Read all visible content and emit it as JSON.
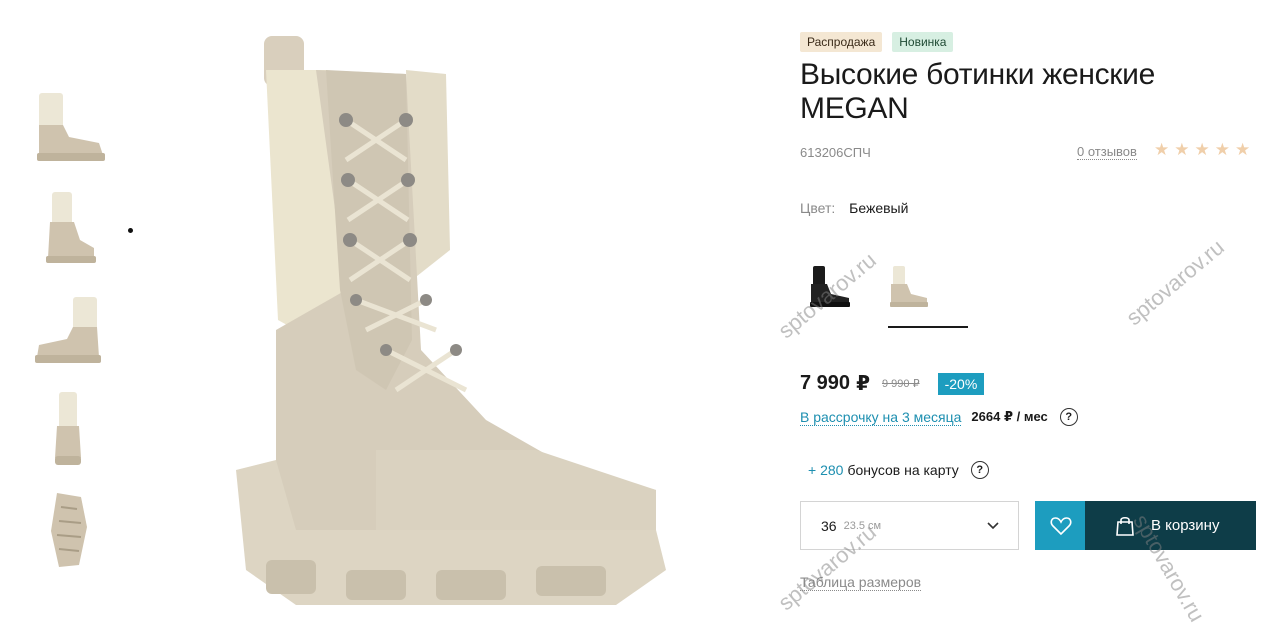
{
  "gallery": {
    "thumbnails": [
      {
        "view": "side",
        "icon": "boot-side-thumbnail"
      },
      {
        "view": "angle",
        "icon": "boot-angle-thumbnail"
      },
      {
        "view": "inner-side",
        "icon": "boot-inner-thumbnail"
      },
      {
        "view": "front",
        "icon": "boot-front-thumbnail"
      },
      {
        "view": "sole",
        "icon": "boot-sole-thumbnail"
      }
    ],
    "main_image": "beige-lace-up-boot-photo"
  },
  "product": {
    "badges": {
      "sale": "Распродажа",
      "new": "Новинка"
    },
    "title": "Высокие ботинки женские MEGAN",
    "sku": "613206СПЧ",
    "reviews": "0 отзывов",
    "rating": 0,
    "stars_total": 5
  },
  "color": {
    "label": "Цвет:",
    "value": "Бежевый",
    "options": [
      "black-boot-swatch",
      "beige-boot-swatch"
    ]
  },
  "pricing": {
    "price": "7 990",
    "currency": "₽",
    "old_price": "9 990 ₽",
    "discount": "-20%",
    "installment_link": "В рассрочку на 3 месяца",
    "installment_amount": "2664 ₽ / мес",
    "help": "?"
  },
  "bonus": {
    "amount": "+ 280",
    "text": "бонусов на карту",
    "help": "?"
  },
  "size": {
    "value": "36",
    "cm": "23.5 см"
  },
  "actions": {
    "cart_label": "В корзину",
    "size_table_label": "Таблица размеров"
  },
  "watermark": "sptovarov.ru",
  "colors": {
    "accent": "#1d9dbf",
    "cart_button": "#0e3d48",
    "sale_badge": "#f4e7d3",
    "new_badge": "#d7efe2",
    "star": "#f0cfaa"
  }
}
